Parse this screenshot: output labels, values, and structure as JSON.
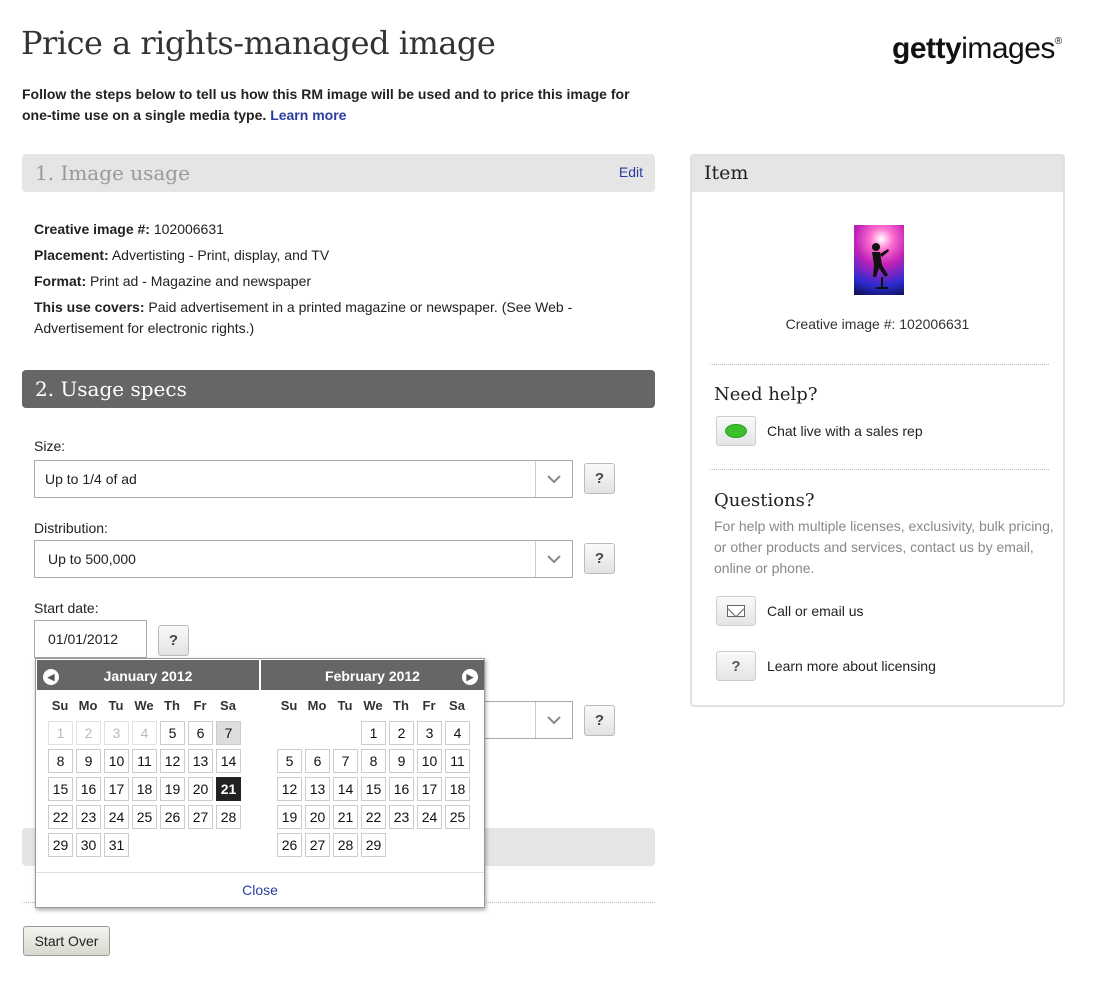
{
  "page": {
    "title": "Price a rights-managed image",
    "intro": "Follow the steps below to tell us how this RM image will be used and to price this image for one-time use on a single media type.",
    "learn_more": "Learn more"
  },
  "logo": {
    "bold": "getty",
    "rest": "images",
    "reg": "®"
  },
  "section1": {
    "title": "1. Image usage",
    "edit": "Edit",
    "image_label": "Creative image #:",
    "image_value": "102006631",
    "placement_label": "Placement:",
    "placement_value": "Advertisting - Print, display, and TV",
    "format_label": "Format:",
    "format_value": "Print ad - Magazine and newspaper",
    "covers_label": "This use covers:",
    "covers_value": "Paid advertisement in a printed magazine or newspaper. (See Web - Advertisement for electronic rights.)"
  },
  "section2": {
    "title": "2. Usage specs",
    "size_label": "Size:",
    "size_value": "Up to 1/4 of ad",
    "distribution_label": "Distribution:",
    "distribution_value": "Up to 500,000",
    "start_label": "Start date:",
    "start_value": "01/01/2012",
    "help": "?"
  },
  "calendar": {
    "left_month": "January 2012",
    "right_month": "February 2012",
    "dow": [
      "Su",
      "Mo",
      "Tu",
      "We",
      "Th",
      "Fr",
      "Sa"
    ],
    "january": {
      "first_weekday": 0,
      "days": 31,
      "disabled_through": 4,
      "today": 7,
      "selected": 21
    },
    "february": {
      "first_weekday": 3,
      "days": 29
    },
    "close": "Close"
  },
  "start_over": "Start Over",
  "item_panel": {
    "title": "Item",
    "caption": "Creative image #: 102006631",
    "help_title": "Need help?",
    "chat": "Chat live with a sales rep",
    "questions_title": "Questions?",
    "questions_text": "For help with multiple licenses, exclusivity, bulk pricing, or other products and services, contact us by email, online or phone.",
    "call": "Call or email us",
    "learn": "Learn more about licensing",
    "help_glyph": "?"
  }
}
